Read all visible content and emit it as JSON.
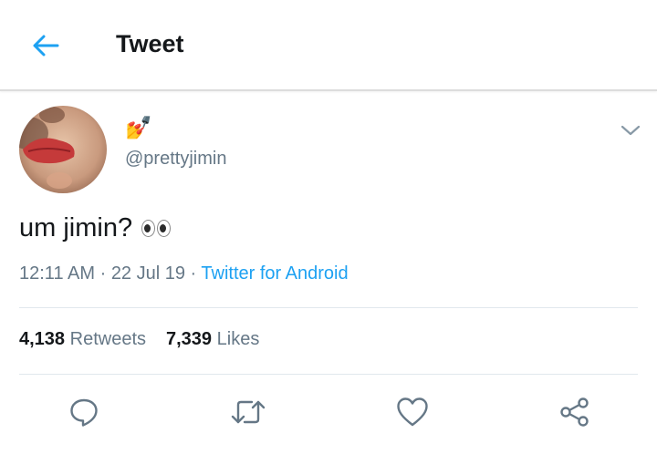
{
  "header": {
    "back_icon": "arrow-left-icon",
    "title": "Tweet",
    "accent_color": "#1da1f2"
  },
  "tweet": {
    "display_name_emoji": "💅",
    "handle": "@prettyjimin",
    "text": "um jimin?",
    "text_emoji": "eyes-emoji",
    "time": "12:11 AM",
    "date": "22 Jul 19",
    "source": "Twitter for Android",
    "caret_icon": "chevron-down-icon"
  },
  "stats": {
    "retweets_count": "4,138",
    "retweets_label": "Retweets",
    "likes_count": "7,339",
    "likes_label": "Likes"
  },
  "actions": {
    "reply_icon": "reply-icon",
    "retweet_icon": "retweet-icon",
    "like_icon": "heart-icon",
    "share_icon": "share-icon",
    "icon_color": "#657786"
  }
}
